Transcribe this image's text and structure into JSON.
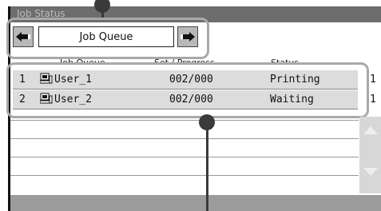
{
  "window": {
    "title": "Job Status"
  },
  "queue_selector": {
    "label": "Job Queue",
    "prev_icon": "left-arrow-icon",
    "next_icon": "right-arrow-icon"
  },
  "columns": [
    "Job Queue",
    "Set / Progress",
    "Status"
  ],
  "jobs": [
    {
      "index": "1",
      "user": "User_1",
      "progress": "002/000",
      "status": "Printing",
      "side": "1"
    },
    {
      "index": "2",
      "user": "User_2",
      "progress": "002/000",
      "status": "Waiting",
      "side": "1"
    }
  ],
  "icons": {
    "user": "pc-user-icon",
    "scroll_up": "scroll-up-icon",
    "scroll_down": "scroll-down-icon"
  },
  "colors": {
    "title_bar": "#6d6d6d",
    "row_bg": "#dcdcdc",
    "frame": "#a9a9a9",
    "callout": "#3a3a3a"
  }
}
